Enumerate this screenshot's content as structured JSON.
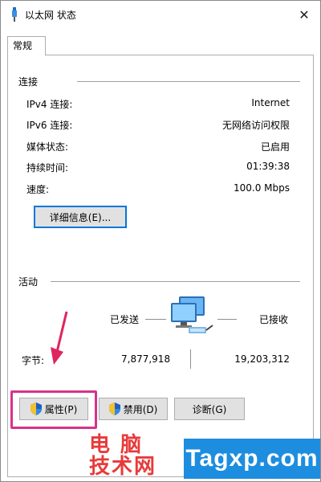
{
  "window": {
    "title": "以太网 状态",
    "close_glyph": "✕"
  },
  "tabs": [
    {
      "label": "常规"
    }
  ],
  "connection": {
    "group_title": "连接",
    "rows": [
      {
        "label": "IPv4 连接:",
        "value": "Internet"
      },
      {
        "label": "IPv6 连接:",
        "value": "无网络访问权限"
      },
      {
        "label": "媒体状态:",
        "value": "已启用"
      },
      {
        "label": "持续时间:",
        "value": "01:39:38"
      },
      {
        "label": "速度:",
        "value": "100.0 Mbps"
      }
    ],
    "details_button": "详细信息(E)..."
  },
  "activity": {
    "group_title": "活动",
    "sent_label": "已发送",
    "received_label": "已接收",
    "bytes_label": "字节:",
    "bytes_sent": "7,877,918",
    "bytes_received": "19,203,312"
  },
  "buttons": {
    "properties": "属性(P)",
    "disable": "禁用(D)",
    "diagnose": "诊断(G)"
  },
  "watermark": {
    "cn_line1": "电 脑",
    "cn_line2": "技术网",
    "en": "Tagxp.com"
  },
  "colors": {
    "highlight": "#d6338a",
    "accent": "#0078d7",
    "watermark_red": "#e83a3a",
    "watermark_blue": "#1d8de0"
  },
  "icons": {
    "title": "ethernet-plug-icon",
    "close": "close-icon",
    "network": "network-computers-icon",
    "shield": "uac-shield-icon"
  }
}
